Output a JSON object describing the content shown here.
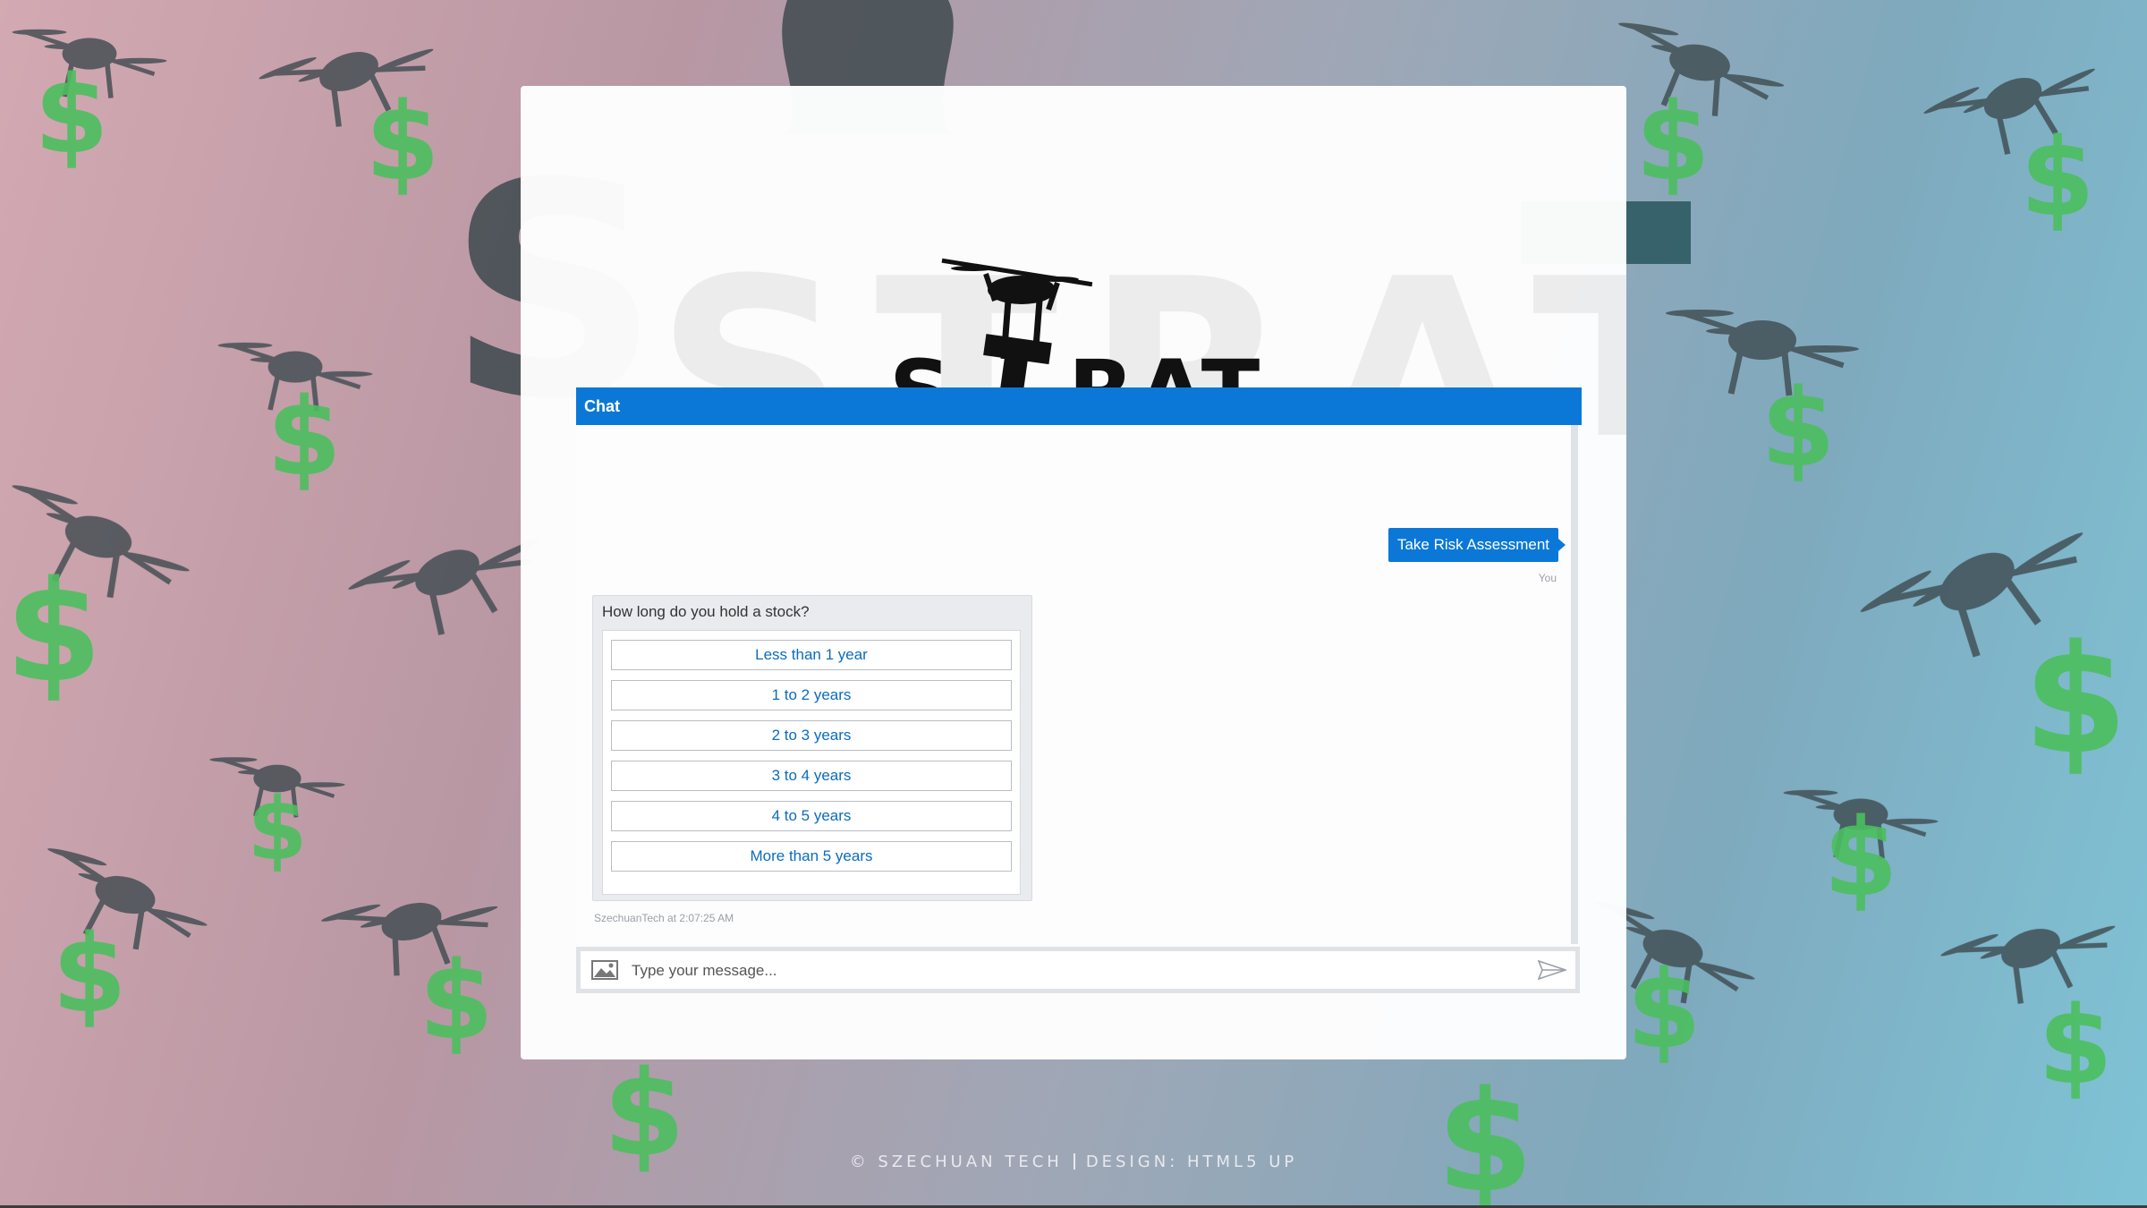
{
  "page": {
    "background_watermark_text": "STRAT",
    "accent_color": "#0b78d7",
    "dollar_color": "#4bbf5e"
  },
  "logo": {
    "text": "STRAT",
    "icon": "drone-icon"
  },
  "chat": {
    "header_title": "Chat",
    "user_message": {
      "text": "Take Risk Assessment",
      "sender": "You"
    },
    "bot_message": {
      "question": "How long do you hold a stock?",
      "choices": [
        "Less than 1 year",
        "1 to 2 years",
        "2 to 3 years",
        "3 to 4 years",
        "4 to 5 years",
        "More than 5 years"
      ],
      "meta": "SzechuanTech at 2:07:25 AM"
    },
    "input": {
      "placeholder": "Type your message...",
      "value": ""
    }
  },
  "footer": {
    "left": "© SZECHUAN TECH",
    "right": "DESIGN: HTML5 UP"
  }
}
